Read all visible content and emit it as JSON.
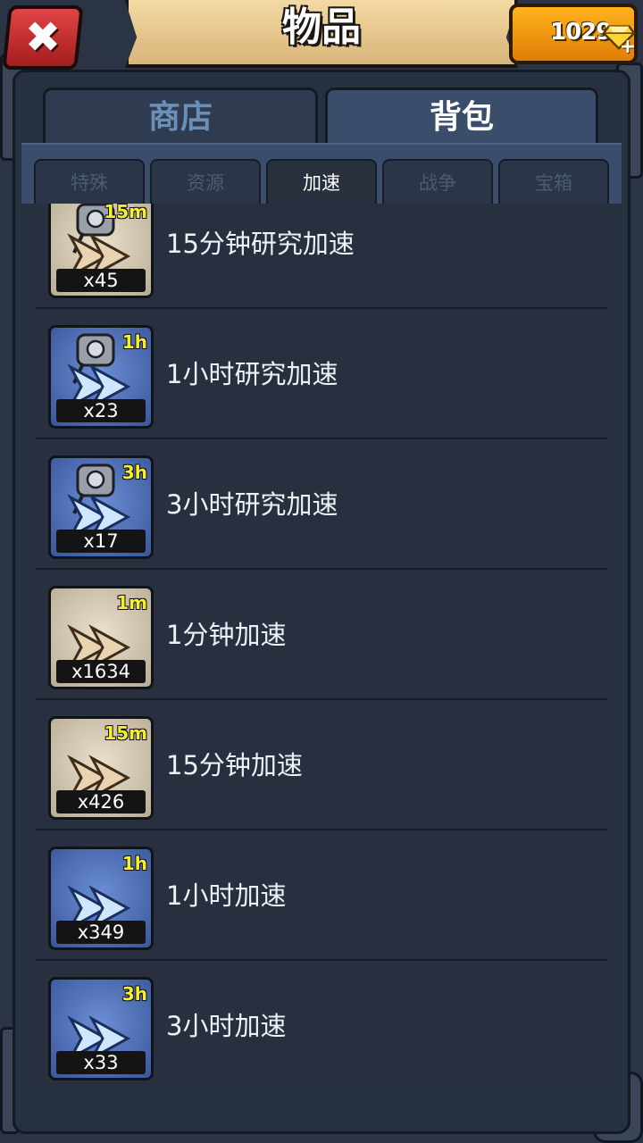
{
  "header": {
    "title": "物品",
    "close_icon": "close-x-icon",
    "gems": "1029",
    "gem_icon": "gem-icon",
    "gem_plus": "+"
  },
  "main_tabs": [
    {
      "label": "商店",
      "active": false
    },
    {
      "label": "背包",
      "active": true
    }
  ],
  "sub_tabs": [
    {
      "label": "特殊",
      "active": false
    },
    {
      "label": "资源",
      "active": false
    },
    {
      "label": "加速",
      "active": true
    },
    {
      "label": "战争",
      "active": false
    },
    {
      "label": "宝箱",
      "active": false
    }
  ],
  "items": [
    {
      "label": "15分钟研究加速",
      "qty": "x45",
      "time": "15m",
      "style": "tan",
      "research": true
    },
    {
      "label": "1小时研究加速",
      "qty": "x23",
      "time": "1h",
      "style": "blue",
      "research": true
    },
    {
      "label": "3小时研究加速",
      "qty": "x17",
      "time": "3h",
      "style": "blue",
      "research": true
    },
    {
      "label": "1分钟加速",
      "qty": "x1634",
      "time": "1m",
      "style": "tan",
      "research": false
    },
    {
      "label": "15分钟加速",
      "qty": "x426",
      "time": "15m",
      "style": "tan",
      "research": false
    },
    {
      "label": "1小时加速",
      "qty": "x349",
      "time": "1h",
      "style": "blue",
      "research": false
    },
    {
      "label": "3小时加速",
      "qty": "x33",
      "time": "3h",
      "style": "blue",
      "research": false
    }
  ]
}
